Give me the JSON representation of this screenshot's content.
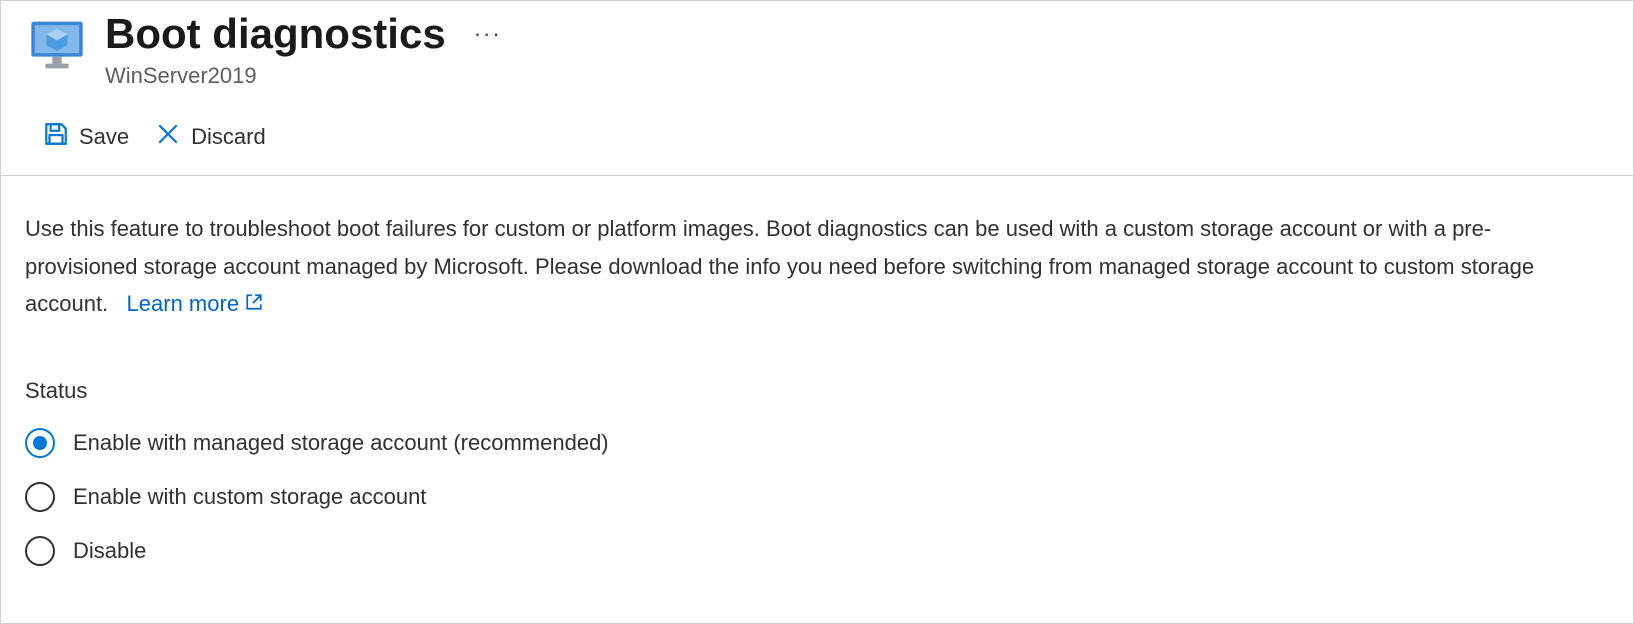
{
  "header": {
    "title": "Boot diagnostics",
    "subtitle": "WinServer2019"
  },
  "toolbar": {
    "save_label": "Save",
    "discard_label": "Discard"
  },
  "content": {
    "description": "Use this feature to troubleshoot boot failures for custom or platform images. Boot diagnostics can be used with a custom storage account or with a pre-provisioned storage account managed by Microsoft. Please download the info you need before switching from managed storage account to custom storage account.",
    "learn_more": "Learn more",
    "status_label": "Status",
    "options": [
      {
        "label": "Enable with managed storage account (recommended)",
        "selected": true
      },
      {
        "label": "Enable with custom storage account",
        "selected": false
      },
      {
        "label": "Disable",
        "selected": false
      }
    ]
  },
  "colors": {
    "accent": "#0078d4",
    "link": "#0066cc"
  }
}
